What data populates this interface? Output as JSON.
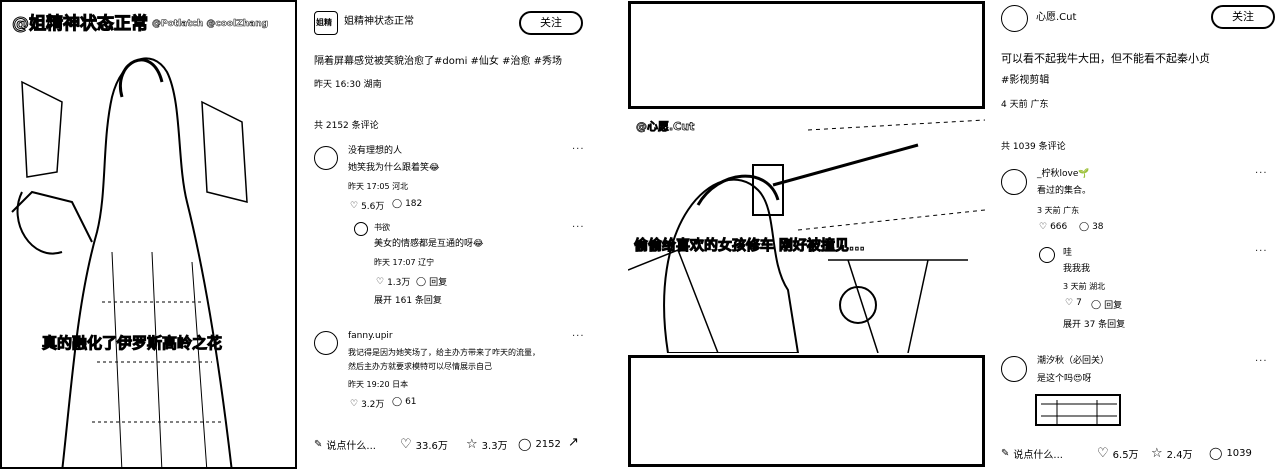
{
  "left_post": {
    "overlay_title": "@姐精神状态正常",
    "overlay_tag": "@Potlatch  @coolZhang",
    "caption_overlay": "真的融化了伊罗斯高岭之花",
    "author": "姐精神状态正常",
    "author_logo": "姐精",
    "follow_label": "关注",
    "description": "隔着屏幕感觉被笑貌治愈了#domi #仙女 #治愈 #秀场",
    "meta": "昨天 16:30 湖南",
    "comment_count": "共 2152 条评论",
    "comments": [
      {
        "user": "没有理想的人",
        "text": "她笑我为什么跟着笑😂",
        "meta": "昨天 17:05 河北",
        "likes": "5.6万",
        "replies_count": "182"
      },
      {
        "user": "书欲",
        "text": "美女的情感都是互通的呀😂",
        "meta": "昨天 17:07 辽宁",
        "likes": "1.3万",
        "reply_label": "回复",
        "is_reply": true,
        "expand": "展开 161 条回复"
      },
      {
        "user": "fanny.upir",
        "text_line1": "我记得是因为她笑场了，给主办方带来了咋天的流量，",
        "text_line2": "然后主办方就要求模特可以尽情展示自己",
        "meta": "昨天 19:20 日本",
        "likes": "3.2万",
        "replies_count": "61"
      }
    ],
    "bottom_bar": {
      "placeholder": "说点什么...",
      "likes": "33.6万",
      "stars": "3.3万",
      "comments": "2152"
    }
  },
  "right_post": {
    "video_watermark": "@心愿.Cut",
    "video_subtitle": "偷偷给喜欢的女孩修车 刚好被撞见...",
    "author": "心愿.Cut",
    "follow_label": "关注",
    "description": "可以看不起我牛大田，但不能看不起秦小贞",
    "tag": "#影视剪辑",
    "meta": "4 天前 广东",
    "comment_count": "共 1039 条评论",
    "comments": [
      {
        "user": "_柠秋love🌱",
        "text": "看过的集合。",
        "meta": "3 天前 广东",
        "likes": "666",
        "replies_count": "38"
      },
      {
        "user": "哇",
        "text": "我我我",
        "meta": "3 天前 湖北",
        "likes": "7",
        "reply_label": "回复",
        "is_reply": true,
        "expand": "展开 37 条回复"
      },
      {
        "user": "潮汐秋（必回关）",
        "text": "是这个吗😍呀"
      }
    ],
    "bottom_bar": {
      "placeholder": "说点什么...",
      "likes": "6.5万",
      "stars": "2.4万",
      "comments": "1039"
    }
  }
}
